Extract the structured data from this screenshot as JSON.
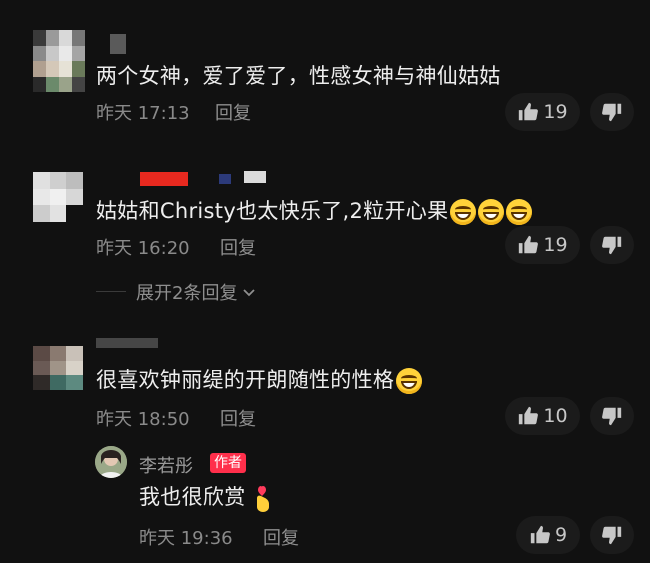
{
  "comments": [
    {
      "text": "两个女神，爱了爱了，性感女神与神仙姑姑",
      "time": "昨天 17:13",
      "reply": "回复",
      "likes": "19"
    },
    {
      "text": "姑姑和Christy也太快乐了,2粒开心果",
      "time": "昨天 16:20",
      "reply": "回复",
      "likes": "19",
      "expand": "展开2条回复"
    },
    {
      "text": "很喜欢钟丽缇的开朗随性的性格",
      "time": "昨天 18:50",
      "reply": "回复",
      "likes": "10"
    }
  ],
  "reply_comment": {
    "username": "李若彤",
    "badge": "作者",
    "text": "我也很欣赏",
    "time": "昨天 19:36",
    "reply": "回复",
    "likes": "9"
  },
  "colors": {
    "background": "#111111",
    "author_badge": "#ff2f4b",
    "meta_text": "#8a8a8a"
  },
  "icons": [
    "thumbs-up-icon",
    "thumbs-down-icon",
    "grinning-emoji-icon",
    "finger-heart-emoji-icon",
    "chevron-down-icon"
  ]
}
